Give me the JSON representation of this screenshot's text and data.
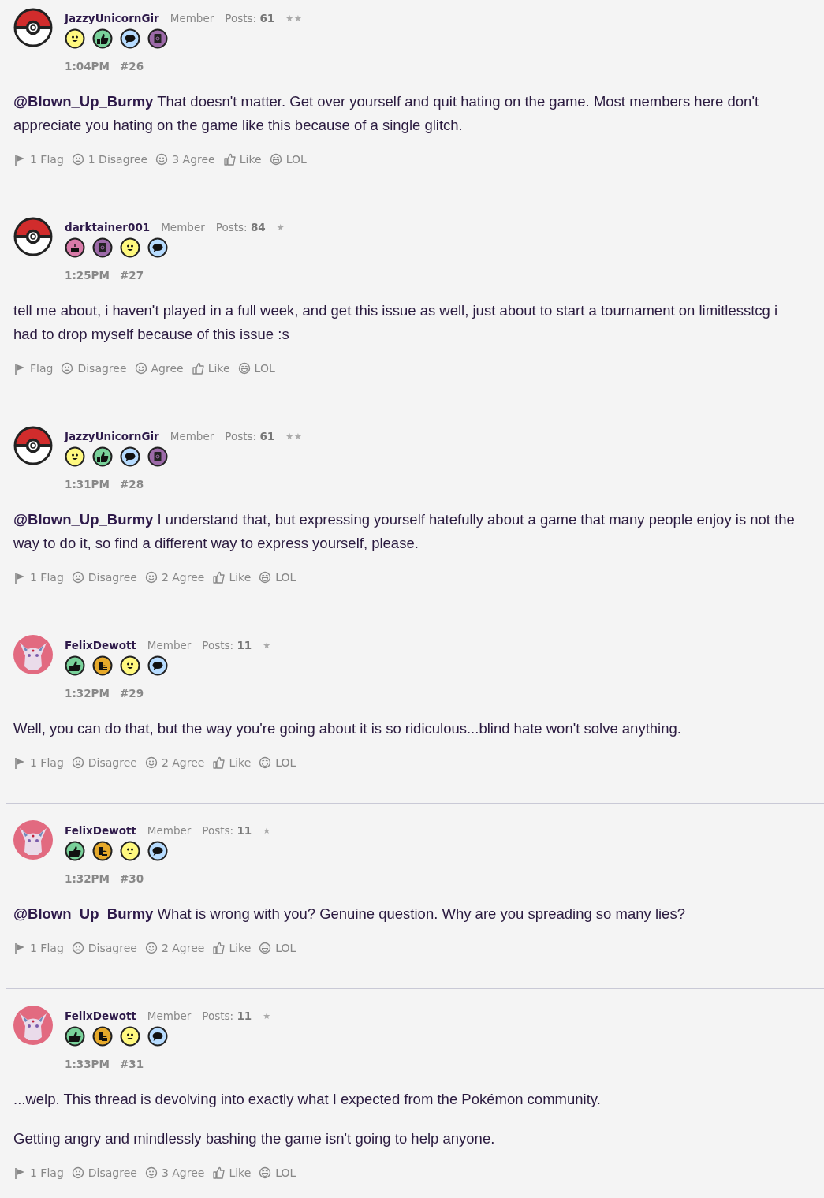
{
  "posts": [
    {
      "avatar": {
        "kind": "pokeball"
      },
      "username": "JazzyUnicornGir",
      "role": "Member",
      "posts_label": "Posts:",
      "posts_count": "61",
      "rank": "★★",
      "badges": [
        {
          "kind": "smiley"
        },
        {
          "kind": "thumb"
        },
        {
          "kind": "chat"
        },
        {
          "kind": "notebook"
        }
      ],
      "time": "1:04PM",
      "number": "#26",
      "paragraphs": [
        [
          "**@Blown_Up_Burmy** That doesn't matter. Get over yourself and quit hating on the game. Most members here don't",
          "appreciate you hating on the game like this because of a single glitch."
        ]
      ],
      "reactions": [
        {
          "kind": "flag",
          "label": "1 Flag"
        },
        {
          "kind": "disagree",
          "label": "1 Disagree"
        },
        {
          "kind": "agree",
          "label": "3 Agree"
        },
        {
          "kind": "like",
          "label": "Like"
        },
        {
          "kind": "lol",
          "label": "LOL"
        }
      ]
    },
    {
      "avatar": {
        "kind": "pokeball"
      },
      "username": "darktainer001",
      "role": "Member",
      "posts_label": "Posts:",
      "posts_count": "84",
      "rank": "★",
      "badges": [
        {
          "kind": "cake"
        },
        {
          "kind": "notebook"
        },
        {
          "kind": "smiley"
        },
        {
          "kind": "chat"
        }
      ],
      "time": "1:25PM",
      "number": "#27",
      "paragraphs": [
        [
          "tell me about, i haven't played in a full week, and get this issue as well, just about to start a tournament on limitlesstcg i",
          "had to drop myself because of this issue :s"
        ]
      ],
      "reactions": [
        {
          "kind": "flag",
          "label": "Flag"
        },
        {
          "kind": "disagree",
          "label": "Disagree"
        },
        {
          "kind": "agree",
          "label": "Agree"
        },
        {
          "kind": "like",
          "label": "Like"
        },
        {
          "kind": "lol",
          "label": "LOL"
        }
      ]
    },
    {
      "avatar": {
        "kind": "pokeball"
      },
      "username": "JazzyUnicornGir",
      "role": "Member",
      "posts_label": "Posts:",
      "posts_count": "61",
      "rank": "★★",
      "badges": [
        {
          "kind": "smiley"
        },
        {
          "kind": "thumb"
        },
        {
          "kind": "chat"
        },
        {
          "kind": "notebook"
        }
      ],
      "time": "1:31PM",
      "number": "#28",
      "paragraphs": [
        [
          "**@Blown_Up_Burmy** I understand that, but expressing yourself hatefully about a game that many people enjoy is not the",
          "way to do it, so find a different way to express yourself, please."
        ]
      ],
      "reactions": [
        {
          "kind": "flag",
          "label": "1 Flag"
        },
        {
          "kind": "disagree",
          "label": "Disagree"
        },
        {
          "kind": "agree",
          "label": "2 Agree"
        },
        {
          "kind": "like",
          "label": "Like"
        },
        {
          "kind": "lol",
          "label": "LOL"
        }
      ]
    },
    {
      "avatar": {
        "kind": "creature"
      },
      "username": "FelixDewott",
      "role": "Member",
      "posts_label": "Posts:",
      "posts_count": "11",
      "rank": "★",
      "badges": [
        {
          "kind": "thumb"
        },
        {
          "kind": "food"
        },
        {
          "kind": "smiley"
        },
        {
          "kind": "chat"
        }
      ],
      "time": "1:32PM",
      "number": "#29",
      "paragraphs": [
        [
          "Well, you can do that, but the way you're going about it is so ridiculous...blind hate won't solve anything."
        ]
      ],
      "reactions": [
        {
          "kind": "flag",
          "label": "1 Flag"
        },
        {
          "kind": "disagree",
          "label": "Disagree"
        },
        {
          "kind": "agree",
          "label": "2 Agree"
        },
        {
          "kind": "like",
          "label": "Like"
        },
        {
          "kind": "lol",
          "label": "LOL"
        }
      ]
    },
    {
      "avatar": {
        "kind": "creature"
      },
      "username": "FelixDewott",
      "role": "Member",
      "posts_label": "Posts:",
      "posts_count": "11",
      "rank": "★",
      "badges": [
        {
          "kind": "thumb"
        },
        {
          "kind": "food"
        },
        {
          "kind": "smiley"
        },
        {
          "kind": "chat"
        }
      ],
      "time": "1:32PM",
      "number": "#30",
      "paragraphs": [
        [
          "**@Blown_Up_Burmy** What is wrong with you? Genuine question. Why are you spreading so many lies?"
        ]
      ],
      "reactions": [
        {
          "kind": "flag",
          "label": "1 Flag"
        },
        {
          "kind": "disagree",
          "label": "Disagree"
        },
        {
          "kind": "agree",
          "label": "2 Agree"
        },
        {
          "kind": "like",
          "label": "Like"
        },
        {
          "kind": "lol",
          "label": "LOL"
        }
      ]
    },
    {
      "avatar": {
        "kind": "creature"
      },
      "username": "FelixDewott",
      "role": "Member",
      "posts_label": "Posts:",
      "posts_count": "11",
      "rank": "★",
      "badges": [
        {
          "kind": "thumb"
        },
        {
          "kind": "food"
        },
        {
          "kind": "smiley"
        },
        {
          "kind": "chat"
        }
      ],
      "time": "1:33PM",
      "number": "#31",
      "paragraphs": [
        [
          "...welp. This thread is devolving into exactly what I expected from the Pokémon community."
        ],
        [
          "Getting angry and mindlessly bashing the game isn't going to help anyone."
        ]
      ],
      "reactions": [
        {
          "kind": "flag",
          "label": "1 Flag"
        },
        {
          "kind": "disagree",
          "label": "Disagree"
        },
        {
          "kind": "agree",
          "label": "3 Agree"
        },
        {
          "kind": "like",
          "label": "Like"
        },
        {
          "kind": "lol",
          "label": "LOL"
        }
      ]
    }
  ]
}
